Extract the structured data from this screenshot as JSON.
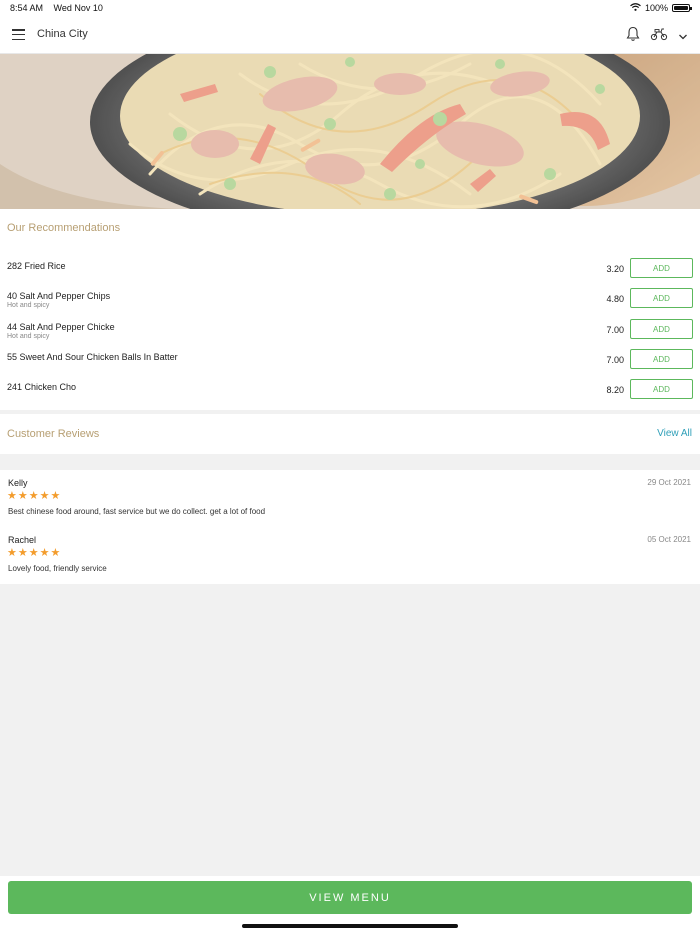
{
  "status_bar": {
    "time": "8:54 AM",
    "date": "Wed Nov 10",
    "battery": "100%",
    "battery_level": 1.0
  },
  "header": {
    "title": "China City"
  },
  "recommendations": {
    "title": "Our Recommendations",
    "items": [
      {
        "name": "282 Fried Rice",
        "desc": "",
        "price": "3.20",
        "add_label": "ADD"
      },
      {
        "name": "40 Salt And Pepper Chips",
        "desc": "Hot and spicy",
        "price": "4.80",
        "add_label": "ADD"
      },
      {
        "name": "44 Salt And Pepper Chicke",
        "desc": "Hot and spicy",
        "price": "7.00",
        "add_label": "ADD"
      },
      {
        "name": "55 Sweet And Sour Chicken Balls In Batter",
        "desc": "",
        "price": "7.00",
        "add_label": "ADD"
      },
      {
        "name": "241 Chicken Cho",
        "desc": "",
        "price": "8.20",
        "add_label": "ADD"
      }
    ]
  },
  "reviews": {
    "title": "Customer Reviews",
    "view_all": "View All",
    "items": [
      {
        "author": "Kelly",
        "date": "29 Oct 2021",
        "rating": 5,
        "text": "Best chinese food around, fast service but we do collect. get a lot of food"
      },
      {
        "author": "Rachel",
        "date": "05 Oct 2021",
        "rating": 5,
        "text": "Lovely food, friendly service"
      }
    ]
  },
  "footer": {
    "view_menu": "VIEW MENU"
  },
  "colors": {
    "accent_green": "#5cb85c",
    "section_title": "#b79f73",
    "link_blue": "#2f9fb8",
    "star": "#f39c2c"
  },
  "icons": {
    "menu": "hamburger-icon",
    "notifications": "bell-icon",
    "delivery": "scooter-icon",
    "dropdown": "chevron-down-icon",
    "wifi": "wifi-icon",
    "battery": "battery-icon",
    "star": "star-icon"
  }
}
